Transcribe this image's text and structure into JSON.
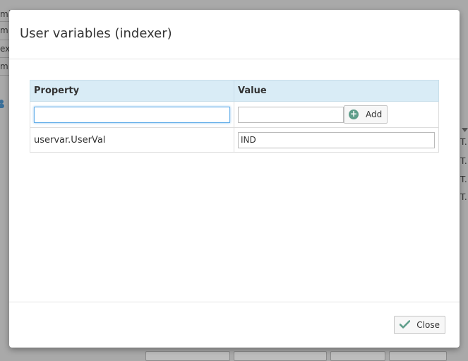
{
  "background": {
    "row_fragments": [
      "mi",
      "m",
      "ex",
      "m"
    ],
    "cell_fragments": [
      "T...",
      "T...",
      "T...",
      "T..."
    ]
  },
  "dialog": {
    "title": "User variables (indexer)",
    "columns": {
      "property": "Property",
      "value": "Value"
    },
    "new_row": {
      "property_value": "",
      "value_value": "",
      "add_label": "Add"
    },
    "rows": [
      {
        "property": "uservar.UserVal",
        "value": "IND"
      }
    ],
    "close_label": "Close"
  },
  "colors": {
    "header_bg": "#d9ecf6",
    "icon_green": "#5f9e8b",
    "focus_border": "#66afe9"
  }
}
